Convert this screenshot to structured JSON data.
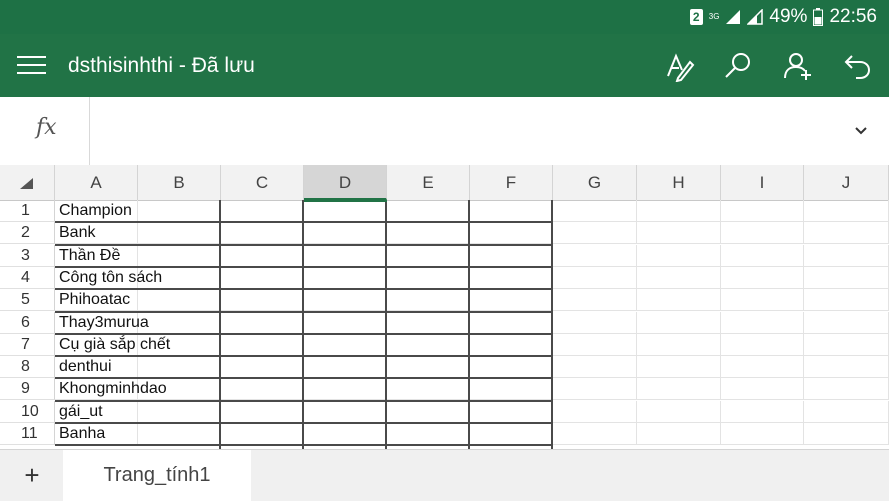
{
  "status_bar": {
    "sim_slot": "2",
    "network": "3G",
    "battery_percent": "49%",
    "time": "22:56"
  },
  "app_bar": {
    "title": "dsthisinhthi - Đã lưu",
    "icons": [
      "menu-icon",
      "draw-pen-icon",
      "search-icon",
      "share-person-icon",
      "undo-icon"
    ]
  },
  "formula_bar": {
    "fx_label": "fx",
    "value": ""
  },
  "columns": [
    "A",
    "B",
    "C",
    "D",
    "E",
    "F",
    "G",
    "H",
    "I",
    "J"
  ],
  "selected_column": "D",
  "rows": [
    {
      "num": "1",
      "a": "Champion"
    },
    {
      "num": "2",
      "a": "Bank"
    },
    {
      "num": "3",
      "a": "Thần Đề"
    },
    {
      "num": "4",
      "a": "Công tôn sách"
    },
    {
      "num": "5",
      "a": "Phihoatac"
    },
    {
      "num": "6",
      "a": "Thay3murua"
    },
    {
      "num": "7",
      "a": "Cụ già sắp chết"
    },
    {
      "num": "8",
      "a": "denthui"
    },
    {
      "num": "9",
      "a": "Khongminhdao"
    },
    {
      "num": "10",
      "a": "gái_ut"
    },
    {
      "num": "11",
      "a": "Banha"
    }
  ],
  "sheet_bar": {
    "add_label": "+",
    "active_sheet": "Trang_tính1"
  }
}
